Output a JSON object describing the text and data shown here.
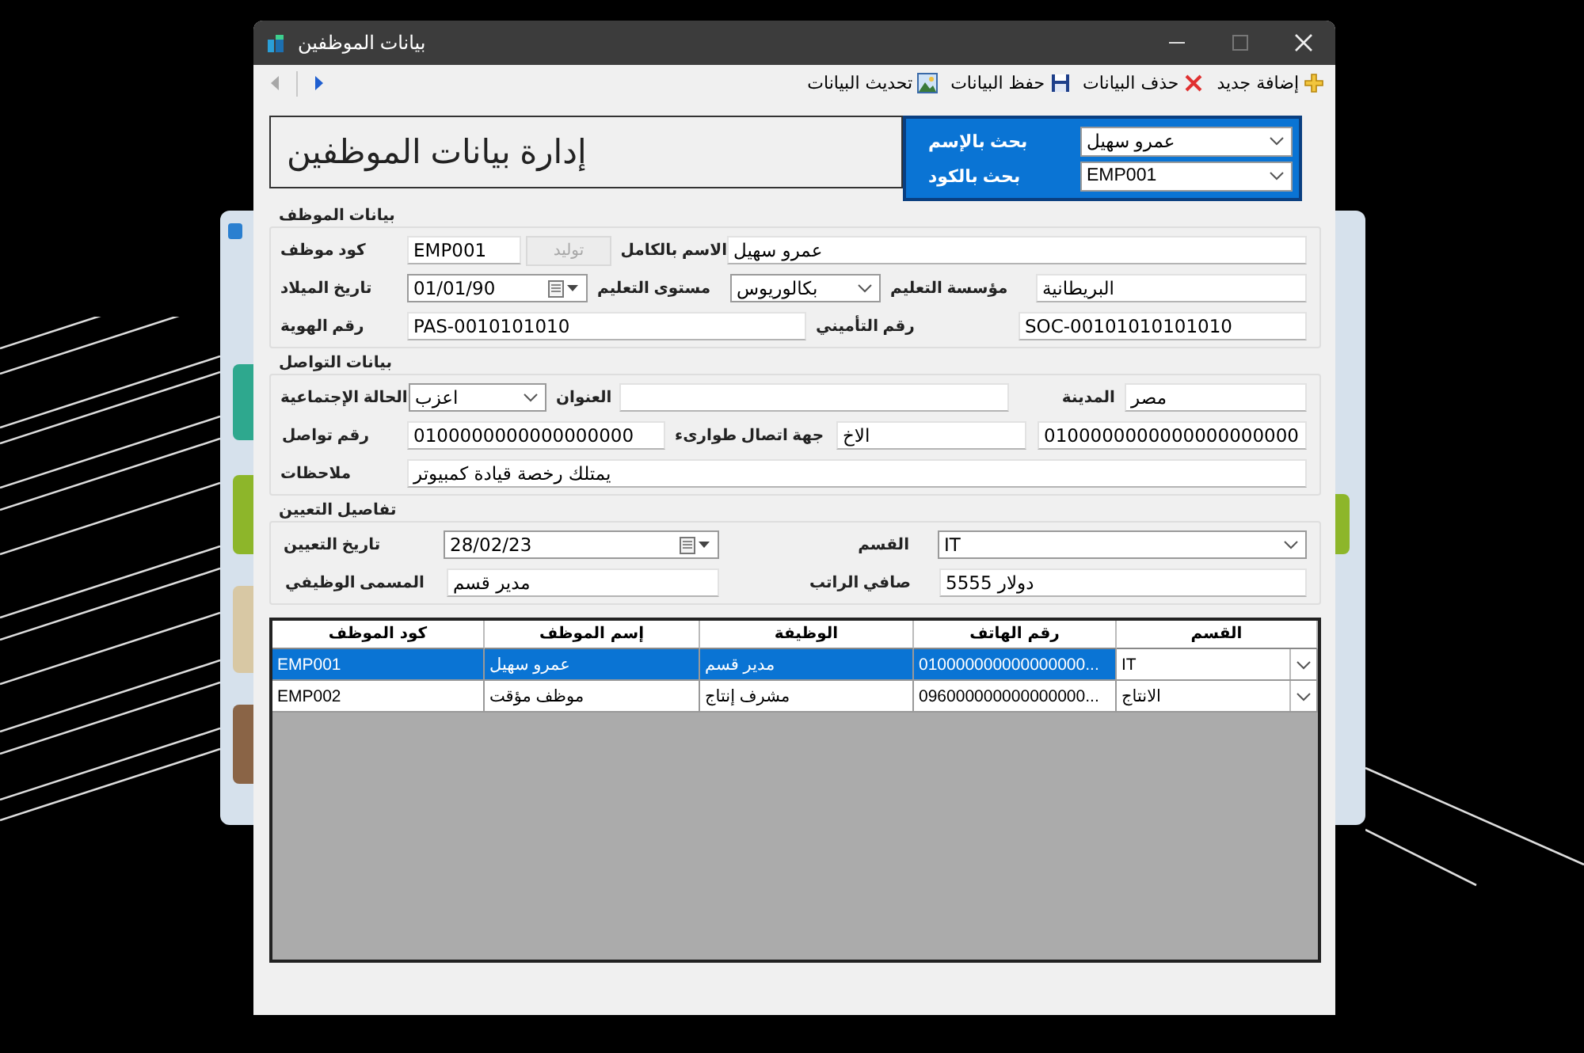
{
  "window": {
    "title": "بيانات الموظفين"
  },
  "toolbar": {
    "items": [
      {
        "kind": "add",
        "label": "إضافة جديد"
      },
      {
        "kind": "delete",
        "label": "حذف البيانات"
      },
      {
        "kind": "save",
        "label": "حفظ البيانات"
      },
      {
        "kind": "refresh",
        "label": "تحديث البيانات"
      }
    ],
    "nav": [
      {
        "kind": "prev",
        "disabled": true
      },
      {
        "kind": "next",
        "disabled": false
      }
    ]
  },
  "header": {
    "title": "إدارة بيانات الموظفين",
    "search": [
      {
        "label": "بحث بالإسم",
        "value": "عمرو سهيل"
      },
      {
        "label": "بحث بالكود",
        "value": "EMP001"
      }
    ]
  },
  "groups": [
    {
      "title": "بيانات الموظف",
      "fields": [
        {
          "label": "الاسم بالكامل",
          "control": {
            "kind": "text",
            "value": "عمرو سهيل"
          }
        },
        {
          "control": {
            "kind": "button",
            "label": "توليد",
            "disabled": true
          }
        },
        {
          "label": "كود موظف",
          "control": {
            "kind": "text",
            "value": "EMP001"
          }
        },
        {
          "label": "مؤسسة التعليم",
          "control": {
            "kind": "text",
            "value": "البريطانية"
          }
        },
        {
          "label": "مستوى التعليم",
          "control": {
            "kind": "combo",
            "value": "بكالوريوس"
          }
        },
        {
          "label": "تاريخ الميلاد",
          "control": {
            "kind": "date",
            "value": "01/01/90"
          }
        },
        {
          "label": "رقم التأميني",
          "control": {
            "kind": "text",
            "value": "SOC-00101010101010"
          }
        },
        {
          "label": "رقم الهوية",
          "control": {
            "kind": "text",
            "value": "PAS-0010101010"
          }
        }
      ]
    },
    {
      "title": "بيانات التواصل",
      "fields": [
        {
          "label": "المدينة",
          "control": {
            "kind": "text",
            "value": "مصر"
          }
        },
        {
          "label": "العنوان",
          "control": {
            "kind": "text"
          }
        },
        {
          "label": "الحالة الإجتماعية",
          "control": {
            "kind": "combo",
            "value": "اعزب"
          }
        },
        {
          "control": {
            "kind": "text",
            "value": "0100000000000000000000"
          }
        },
        {
          "label": "جهة اتصال طوارىء",
          "control": {
            "kind": "text",
            "value": "الاخ"
          }
        },
        {
          "label": "رقم تواصل",
          "control": {
            "kind": "text",
            "value": "0100000000000000000"
          }
        },
        {
          "label": "ملاحظات",
          "control": {
            "kind": "text",
            "value": "يمتلك رخصة قيادة كمبيوتر"
          }
        }
      ]
    },
    {
      "title": "تفاصيل التعيين",
      "fields": [
        {
          "label": "القسم",
          "control": {
            "kind": "combo",
            "value": "IT"
          }
        },
        {
          "label": "تاريخ التعيين",
          "control": {
            "kind": "date",
            "value": "28/02/23"
          }
        },
        {
          "label": "صافي الراتب",
          "control": {
            "kind": "text",
            "value": "دولار 5555"
          }
        },
        {
          "label": "المسمى الوظيفي",
          "control": {
            "kind": "text",
            "value": "مدير قسم"
          }
        }
      ]
    }
  ],
  "grid": {
    "columns": [
      "القسم",
      "رقم الهاتف",
      "الوظيفة",
      "إسم الموظف",
      "كود الموظف"
    ],
    "rows": [
      {
        "selected": true,
        "cells": [
          "IT",
          "010000000000000000...",
          "مدير قسم",
          "عمرو سهيل",
          "EMP001"
        ]
      },
      {
        "selected": false,
        "cells": [
          "الانتاج",
          "096000000000000000...",
          "مشرف إنتاج",
          "موظف مؤقت",
          "EMP002"
        ]
      }
    ]
  }
}
